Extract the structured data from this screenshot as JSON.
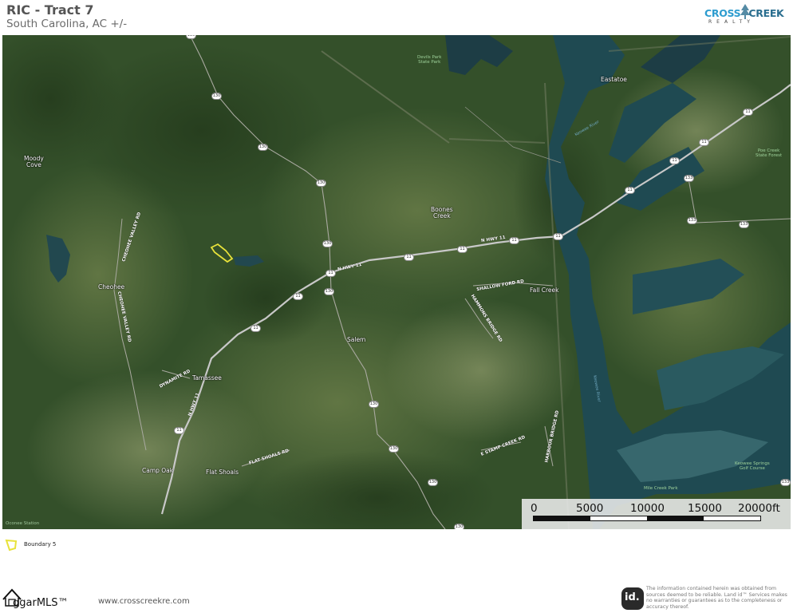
{
  "header": {
    "title": "RIC - Tract 7",
    "subtitle": "South Carolina,  AC +/-"
  },
  "logo": {
    "cross": "CROSS",
    "creek": "CREEK",
    "realty": "REALTY"
  },
  "map": {
    "places": [
      {
        "id": "moody-cove",
        "label": "Moody\nCove"
      },
      {
        "id": "cheohee",
        "label": "Cheohee"
      },
      {
        "id": "tamassee",
        "label": "Tamassee"
      },
      {
        "id": "camp-oak",
        "label": "Camp Oak"
      },
      {
        "id": "flat-shoals",
        "label": "Flat Shoals"
      },
      {
        "id": "salem",
        "label": "Salem"
      },
      {
        "id": "boones-creek",
        "label": "Boones\nCreek"
      },
      {
        "id": "fall-creek",
        "label": "Fall Creek"
      },
      {
        "id": "eastatoe",
        "label": "Eastatoe"
      }
    ],
    "parks": [
      {
        "id": "devils-fork",
        "label": "Devils Fork\nState Park"
      },
      {
        "id": "poe-creek",
        "label": "Poe Creek\nState Forest"
      },
      {
        "id": "keowee-springs",
        "label": "Keowee Springs\nGolf Course"
      },
      {
        "id": "mile-creek",
        "label": "Mile Creek Park"
      },
      {
        "id": "oconee-station",
        "label": "Oconee Station\nState Historic Site"
      }
    ],
    "roads": [
      {
        "id": "n-hwy-11-a",
        "label": "N HWY 11"
      },
      {
        "id": "n-hwy-11-b",
        "label": "N HWY 11"
      },
      {
        "id": "n-hwy-11-c",
        "label": "N HWY 11"
      },
      {
        "id": "cheohee-valley-rd-a",
        "label": "CHEOHEE VALLEY RD"
      },
      {
        "id": "cheohee-valley-rd-b",
        "label": "CHEOHEE VALLEY RD"
      },
      {
        "id": "dynamite-rd",
        "label": "DYNAMITE RD"
      },
      {
        "id": "flat-shoals-rd",
        "label": "FLAT SHOALS RD"
      },
      {
        "id": "shallow-ford-rd",
        "label": "SHALLOW FORD RD"
      },
      {
        "id": "hamlet-bridge-rd",
        "label": "HAMMONS BRIDGE RD"
      },
      {
        "id": "e-stamp-creek-rd",
        "label": "E STAMP CREEK RD"
      },
      {
        "id": "harbour-bridge-rd",
        "label": "HARBOUR BRIDGE RD"
      }
    ],
    "water": [
      {
        "id": "keowee-river",
        "label": "Keowee River"
      },
      {
        "id": "keowee-river-2",
        "label": "Keowee River"
      }
    ],
    "shields": [
      {
        "id": "s130-1",
        "label": "130"
      },
      {
        "id": "s130-2",
        "label": "130"
      },
      {
        "id": "s130-3",
        "label": "130"
      },
      {
        "id": "s130-4",
        "label": "130"
      },
      {
        "id": "s130-5",
        "label": "130"
      },
      {
        "id": "s130-6",
        "label": "130"
      },
      {
        "id": "s130-7",
        "label": "130"
      },
      {
        "id": "s130-8",
        "label": "130"
      },
      {
        "id": "s130-9",
        "label": "130"
      },
      {
        "id": "s130-10",
        "label": "130"
      },
      {
        "id": "s11-1",
        "label": "11"
      },
      {
        "id": "s11-2",
        "label": "11"
      },
      {
        "id": "s11-3",
        "label": "11"
      },
      {
        "id": "s11-4",
        "label": "11"
      },
      {
        "id": "s11-5",
        "label": "11"
      },
      {
        "id": "s11-6",
        "label": "11"
      },
      {
        "id": "s11-7",
        "label": "11"
      },
      {
        "id": "s11-8",
        "label": "11"
      },
      {
        "id": "s11-9",
        "label": "11"
      },
      {
        "id": "s11-10",
        "label": "11"
      },
      {
        "id": "s11-11",
        "label": "11"
      },
      {
        "id": "s11-12",
        "label": "11"
      },
      {
        "id": "s133-1",
        "label": "133"
      },
      {
        "id": "s133-2",
        "label": "133"
      },
      {
        "id": "s133-3",
        "label": "133"
      },
      {
        "id": "s133-4",
        "label": "133"
      }
    ]
  },
  "scale": {
    "ticks": [
      "0",
      "5000",
      "10000",
      "15000",
      "20000ft"
    ]
  },
  "legend": {
    "boundary_label": "Boundary 5",
    "boundary_color": "#e8e23a"
  },
  "footer": {
    "mls_name": "ggarMLS™",
    "website": "www.crosscreekre.com",
    "landid_mark": "id.",
    "disclaimer": "The information contained herein was obtained from sources deemed to be reliable. Land id™ Services makes no warranties or guarantees as to the completeness or accuracy thereof."
  },
  "colors": {
    "forest": "#2f4a25",
    "water": "#1f4a52",
    "road": "#c8c8c8",
    "title_gray": "#555555"
  }
}
